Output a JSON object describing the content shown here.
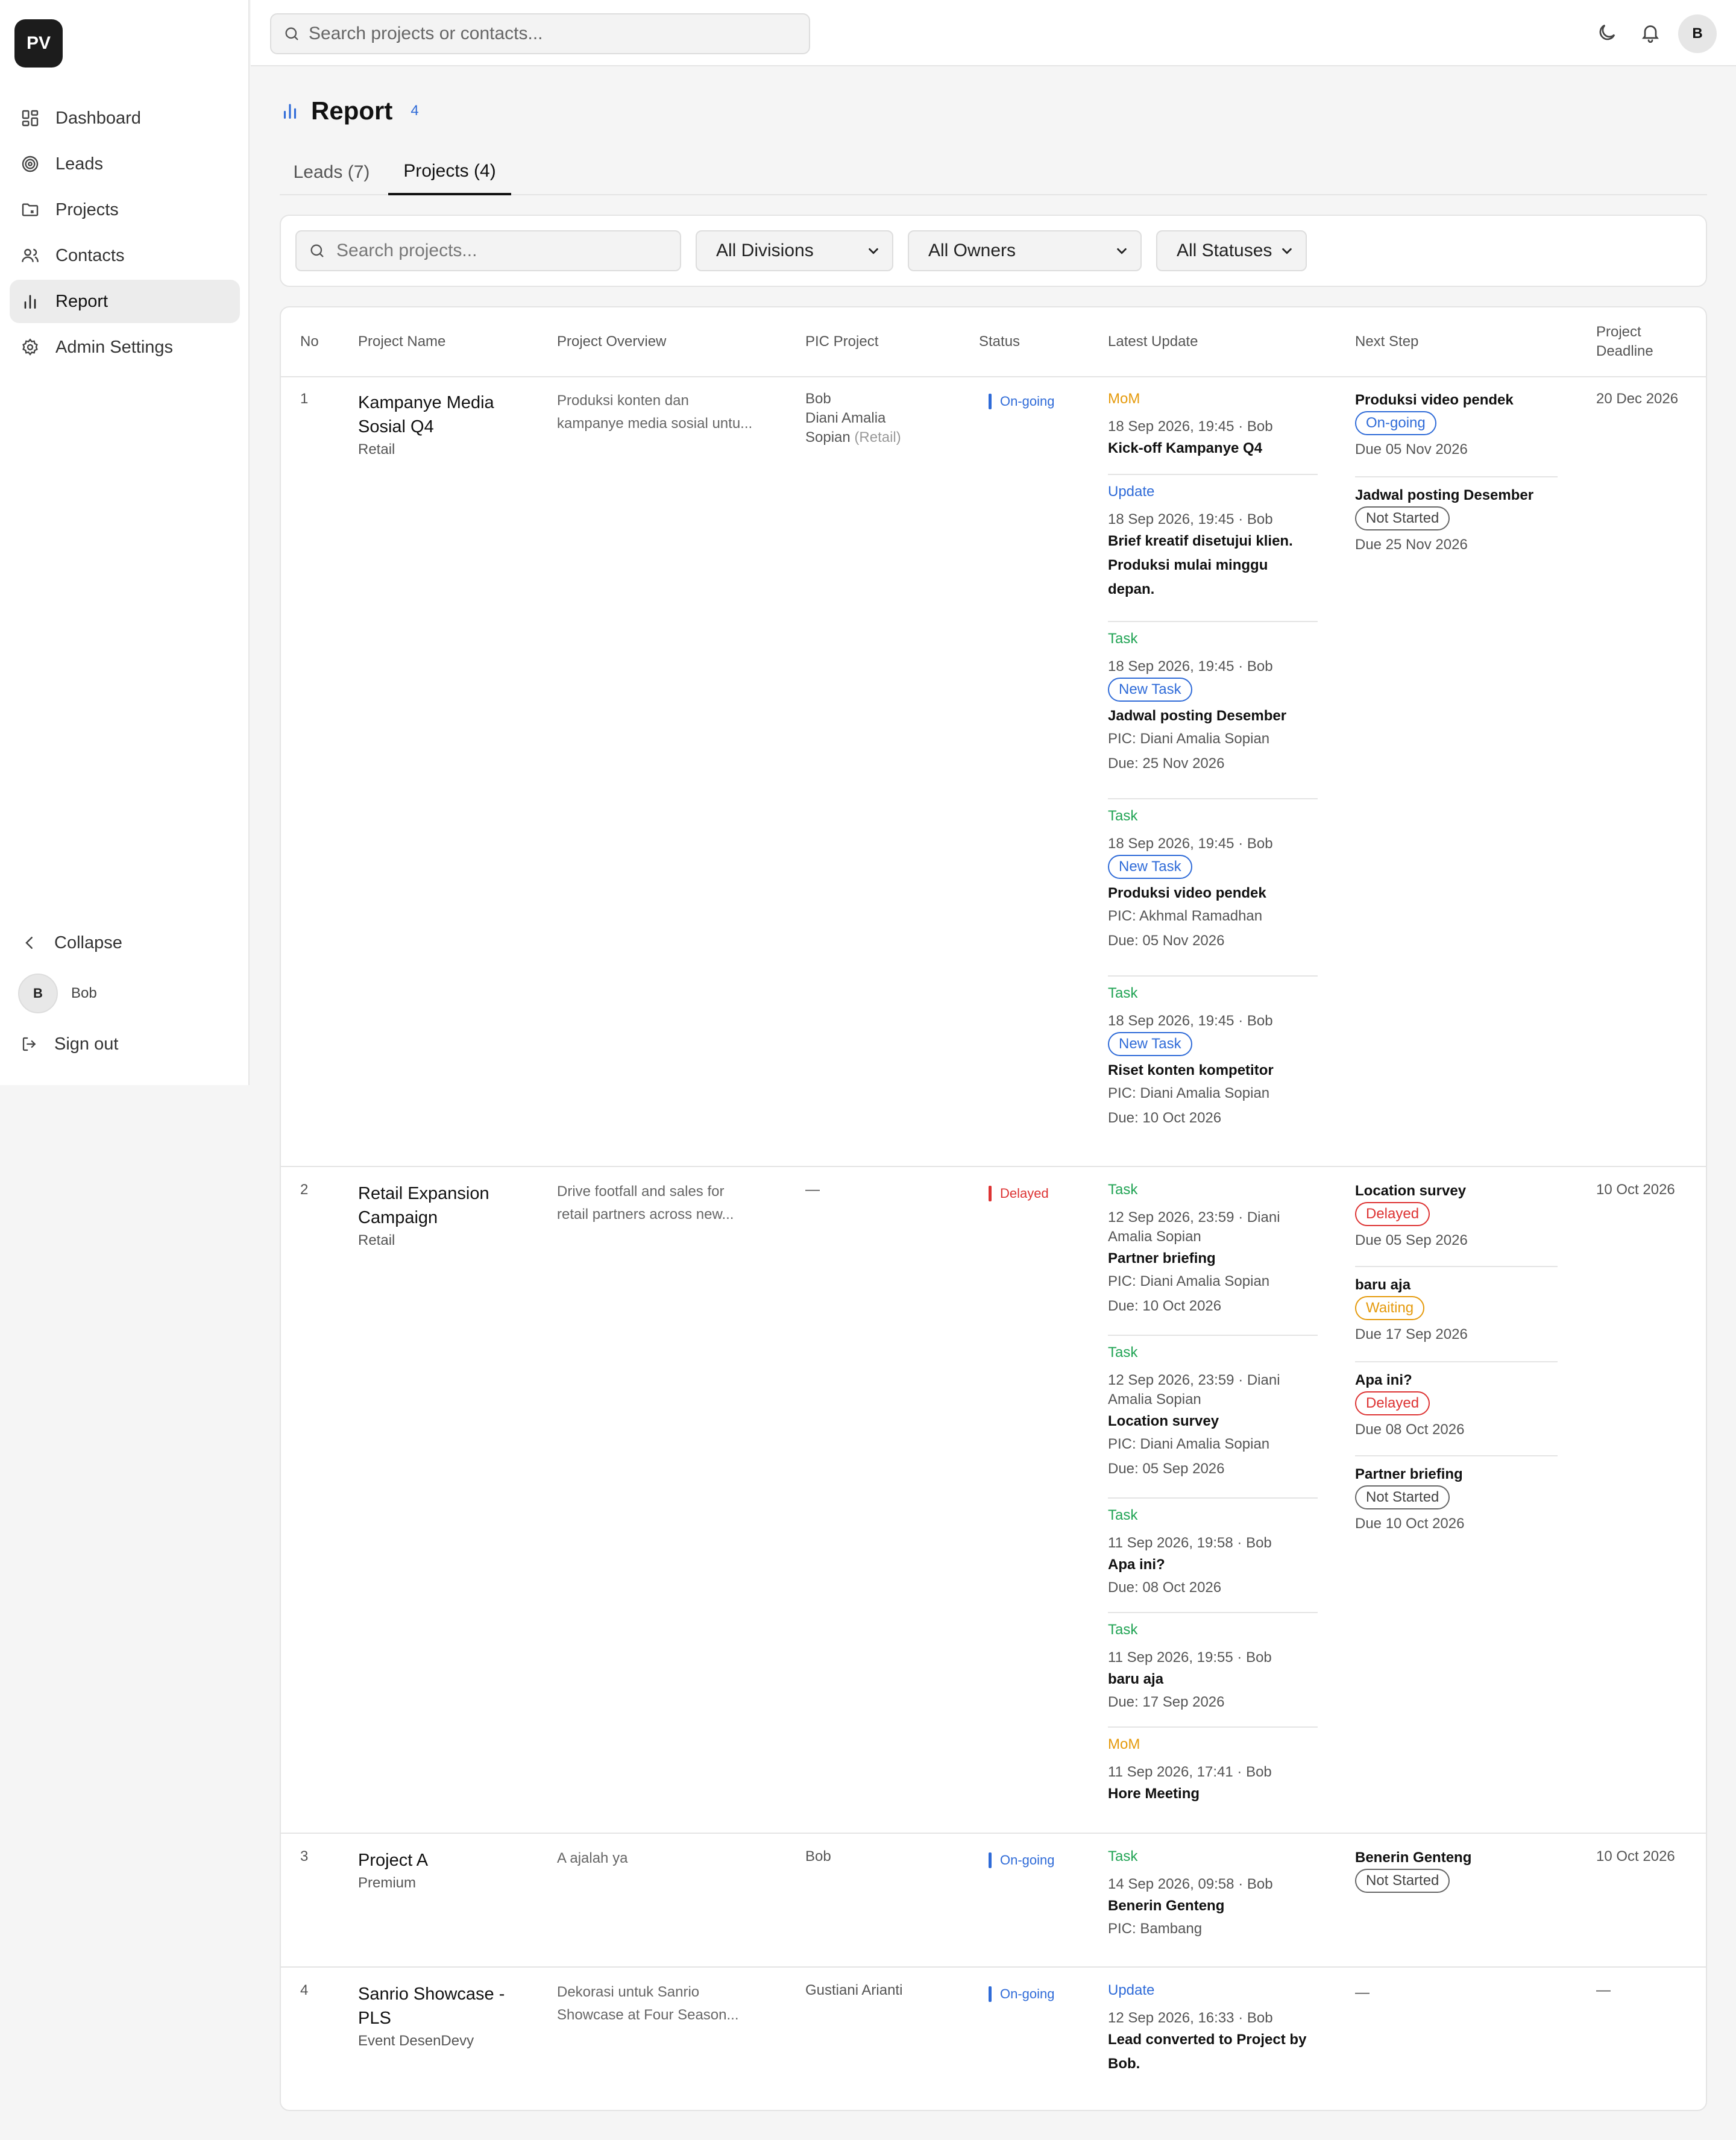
{
  "sidebar": {
    "logo": "PV",
    "nav": [
      {
        "label": "Dashboard",
        "icon": "dashboard-icon"
      },
      {
        "label": "Leads",
        "icon": "target-icon"
      },
      {
        "label": "Projects",
        "icon": "folder-icon"
      },
      {
        "label": "Contacts",
        "icon": "users-icon"
      },
      {
        "label": "Report",
        "icon": "bar-chart-icon",
        "active": true
      },
      {
        "label": "Admin Settings",
        "icon": "gear-icon"
      }
    ],
    "collapse_label": "Collapse",
    "user": {
      "initial": "B",
      "name": "Bob"
    },
    "signout_label": "Sign out"
  },
  "topbar": {
    "search_placeholder": "Search projects or contacts...",
    "avatar_initial": "B"
  },
  "page": {
    "title": "Report",
    "count": "4",
    "tabs": [
      {
        "label": "Leads (7)",
        "active": false
      },
      {
        "label": "Projects (4)",
        "active": true
      }
    ]
  },
  "filters": {
    "search_placeholder": "Search projects...",
    "division": "All Divisions",
    "owner": "All Owners",
    "status": "All Statuses"
  },
  "table": {
    "headers": {
      "no": "No",
      "name": "Project Name",
      "overview": "Project Overview",
      "pic": "PIC Project",
      "status": "Status",
      "latest": "Latest Update",
      "next": "Next Step",
      "deadline_1": "Project",
      "deadline_2": "Deadline"
    },
    "rows": [
      {
        "no": "1",
        "name_1": "Kampanye Media",
        "name_2": "Sosial Q4",
        "category": "Retail",
        "overview_1": "Produksi konten dan",
        "overview_2": "kampanye media sosial untu...",
        "pic_1": "Bob",
        "pic_2": "Diani Amalia",
        "pic_3": "Sopian",
        "pic_3_note": "(Retail)",
        "status": "On-going",
        "deadline": "20 Dec 2026",
        "updates": [
          {
            "kind": "MoM",
            "meta": "18 Sep 2026, 19:45 · Bob",
            "title": "Kick-off Kampanye Q4"
          },
          {
            "kind": "Update",
            "meta": "18 Sep 2026, 19:45 · Bob",
            "title_1": "Brief kreatif disetujui klien.",
            "title_2": "Produksi mulai minggu",
            "title_3": "depan."
          },
          {
            "kind": "Task",
            "meta": "18 Sep 2026, 19:45 · Bob",
            "pill": "New Task",
            "title": "Jadwal posting Desember",
            "pic": "PIC: Diani Amalia Sopian",
            "due": "Due: 25 Nov 2026"
          },
          {
            "kind": "Task",
            "meta": "18 Sep 2026, 19:45 · Bob",
            "pill": "New Task",
            "title": "Produksi video pendek",
            "pic": "PIC: Akhmal Ramadhan",
            "due": "Due: 05 Nov 2026"
          },
          {
            "kind": "Task",
            "meta": "18 Sep 2026, 19:45 · Bob",
            "pill": "New Task",
            "title": "Riset konten kompetitor",
            "pic": "PIC: Diani Amalia Sopian",
            "due": "Due: 10 Oct 2026"
          }
        ],
        "next_steps": [
          {
            "title": "Produksi video pendek",
            "status": "On-going",
            "due": "Due 05 Nov 2026"
          },
          {
            "title": "Jadwal posting Desember",
            "status": "Not Started",
            "due": "Due 25 Nov 2026"
          }
        ]
      },
      {
        "no": "2",
        "name_1": "Retail Expansion",
        "name_2": "Campaign",
        "category": "Retail",
        "overview_1": "Drive footfall and sales for",
        "overview_2": "retail partners across new...",
        "pic_1": "—",
        "status": "Delayed",
        "deadline": "10 Oct 2026",
        "updates": [
          {
            "kind": "Task",
            "meta_1": "12 Sep 2026, 23:59 · Diani",
            "meta_2": "Amalia Sopian",
            "title": "Partner briefing",
            "pic": "PIC: Diani Amalia Sopian",
            "due": "Due: 10 Oct 2026"
          },
          {
            "kind": "Task",
            "meta_1": "12 Sep 2026, 23:59 · Diani",
            "meta_2": "Amalia Sopian",
            "title": "Location survey",
            "pic": "PIC: Diani Amalia Sopian",
            "due": "Due: 05 Sep 2026"
          },
          {
            "kind": "Task",
            "meta": "11 Sep 2026, 19:58 · Bob",
            "title": "Apa ini?",
            "due": "Due: 08 Oct 2026"
          },
          {
            "kind": "Task",
            "meta": "11 Sep 2026, 19:55 · Bob",
            "title": "baru aja",
            "due": "Due: 17 Sep 2026"
          },
          {
            "kind": "MoM",
            "meta": "11 Sep 2026, 17:41 · Bob",
            "title": "Hore Meeting"
          }
        ],
        "next_steps": [
          {
            "title": "Location survey",
            "status": "Delayed",
            "due": "Due 05 Sep 2026"
          },
          {
            "title": "baru aja",
            "status": "Waiting",
            "due": "Due 17 Sep 2026"
          },
          {
            "title": "Apa ini?",
            "status": "Delayed",
            "due": "Due 08 Oct 2026"
          },
          {
            "title": "Partner briefing",
            "status": "Not Started",
            "due": "Due 10 Oct 2026"
          }
        ]
      },
      {
        "no": "3",
        "name_1": "Project A",
        "category": "Premium",
        "overview_1": "A ajalah ya",
        "pic_1": "Bob",
        "status": "On-going",
        "deadline": "10 Oct 2026",
        "updates": [
          {
            "kind": "Task",
            "meta": "14 Sep 2026, 09:58 · Bob",
            "title": "Benerin Genteng",
            "pic": "PIC: Bambang"
          }
        ],
        "next_steps": [
          {
            "title": "Benerin Genteng",
            "status": "Not Started"
          }
        ]
      },
      {
        "no": "4",
        "name_1": "Sanrio Showcase -",
        "name_2": "PLS",
        "category": "Event DesenDevy",
        "overview_1": "Dekorasi untuk Sanrio",
        "overview_2": "Showcase at Four Season...",
        "pic_1": "Gustiani Arianti",
        "status": "On-going",
        "deadline": "—",
        "next_empty": "—",
        "updates": [
          {
            "kind": "Update",
            "meta": "12 Sep 2026, 16:33 · Bob",
            "title_1": "Lead converted to Project by",
            "title_2": "Bob."
          }
        ]
      }
    ]
  }
}
